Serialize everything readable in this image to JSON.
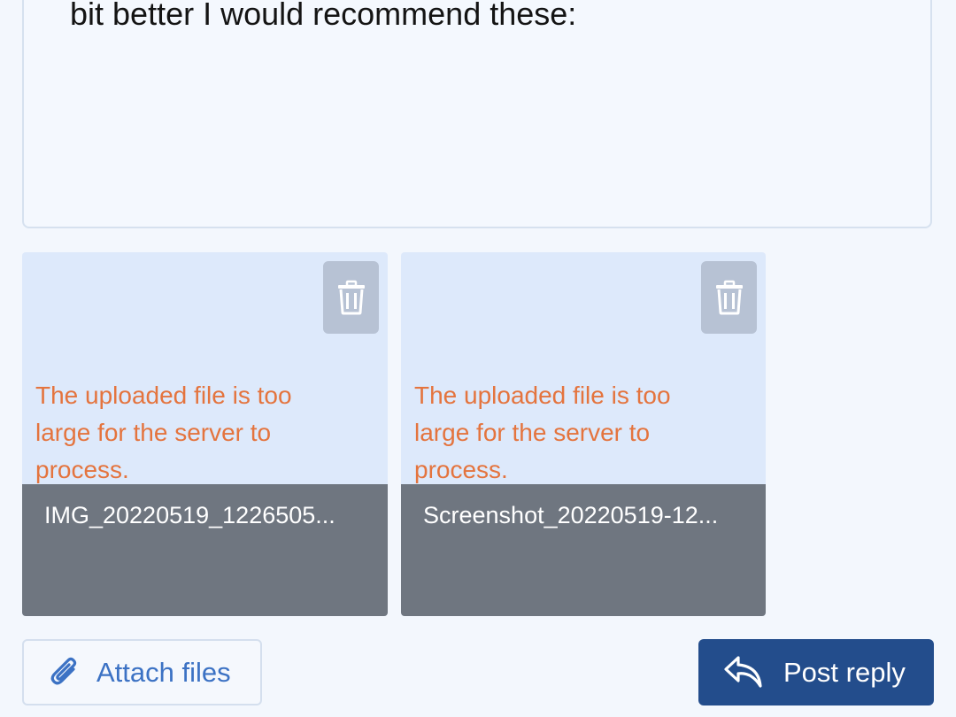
{
  "editor": {
    "visible_text": "bit better I would recommend these:"
  },
  "attachments": [
    {
      "error": "The uploaded file is too large for the server to process.",
      "filename": "IMG_20220519_1226505...",
      "delete_icon": "trash-icon"
    },
    {
      "error": "The uploaded file is too large for the server to process.",
      "filename": "Screenshot_20220519-12...",
      "delete_icon": "trash-icon"
    }
  ],
  "actions": {
    "attach_label": "Attach files",
    "attach_icon": "paperclip-icon",
    "post_label": "Post reply",
    "post_icon": "reply-arrow-icon"
  },
  "colors": {
    "background": "#f3f7fd",
    "error_text": "#e4743e",
    "primary_button": "#234d8c",
    "link_text": "#3c72c4",
    "file_bar": "#6f7680"
  }
}
